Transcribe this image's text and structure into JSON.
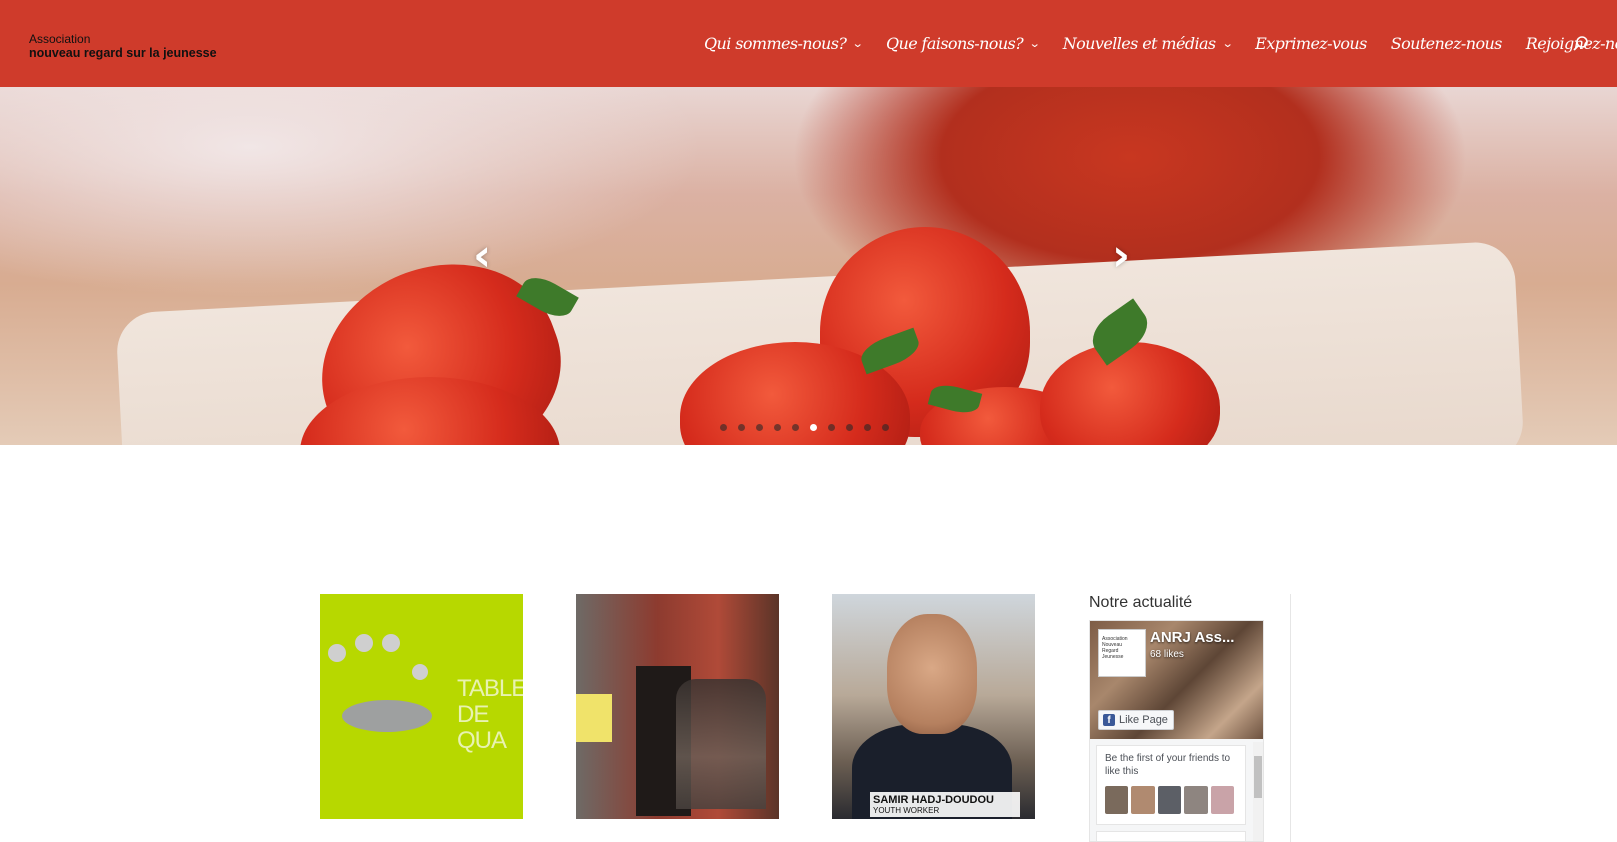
{
  "header": {
    "logo_line1": "Association",
    "logo_line2": "nouveau regard sur la jeunesse",
    "nav": [
      {
        "label": "Qui sommes-nous?",
        "has_dropdown": true
      },
      {
        "label": "Que faisons-nous?",
        "has_dropdown": true
      },
      {
        "label": "Nouvelles et médias",
        "has_dropdown": true
      },
      {
        "label": "Exprimez-vous",
        "has_dropdown": false
      },
      {
        "label": "Soutenez-nous",
        "has_dropdown": false
      },
      {
        "label": "Rejoignez-nous",
        "has_dropdown": false
      }
    ],
    "search_icon": "search-icon",
    "chevron": "⌄",
    "bg_color": "#cf3b2b"
  },
  "slider": {
    "prev_arrow": "‹",
    "next_arrow": "›",
    "slide_count": 10,
    "active_slide_index": 5
  },
  "cards": [
    {
      "title_line1": "TABLES",
      "title_line2": "DE QUA"
    },
    {},
    {
      "caption_name": "SAMIR HADJ-DOUDOU",
      "caption_role": "YOUTH WORKER"
    }
  ],
  "sidebar": {
    "title": "Notre actualité",
    "fb_page_name": "ANRJ Ass...",
    "fb_likes": "68 likes",
    "fb_like_button": "Like Page",
    "fb_friends_text": "Be the first of your friends to like this",
    "fb_logo_lines": [
      "Association",
      "Nouveau",
      "Regard",
      "Jeunesse"
    ]
  }
}
